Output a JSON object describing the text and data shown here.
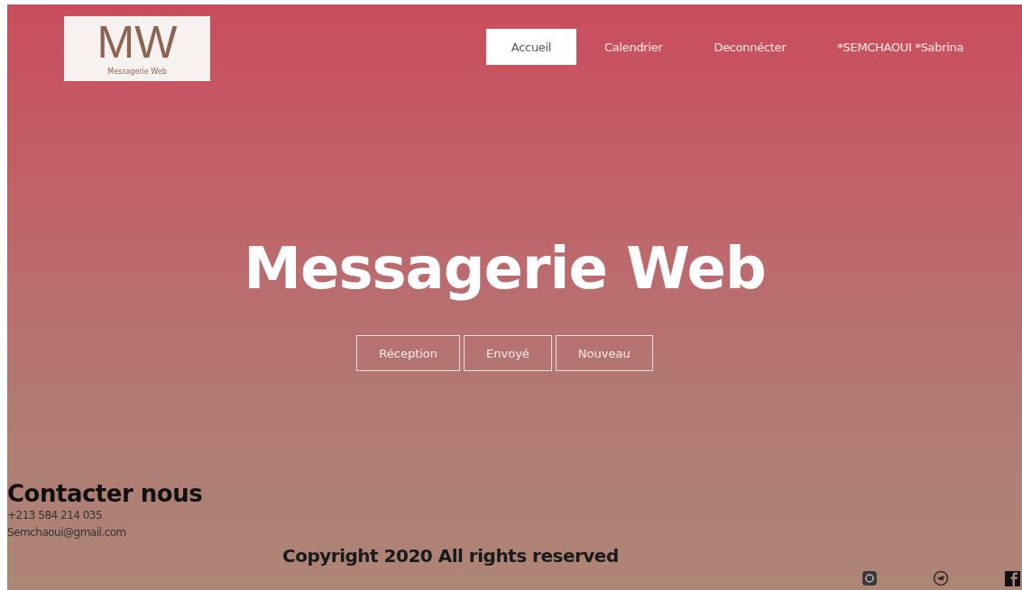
{
  "logo": {
    "mark": "MW",
    "caption": "Messagerie Web"
  },
  "nav": [
    {
      "label": "Accueil",
      "selected": true
    },
    {
      "label": "Calendrier",
      "selected": false
    },
    {
      "label": "Deconnécter",
      "selected": false
    },
    {
      "label": "*SEMCHAOUI *Sabrina",
      "selected": false
    }
  ],
  "hero": {
    "title": "Messagerie Web",
    "buttons": [
      "Réception",
      "Envoyé",
      "Nouveau"
    ]
  },
  "contact": {
    "heading": "Contacter nous",
    "phone": "+213 584 214 035",
    "email": "Semchaoui@gmail.com"
  },
  "copyright": "Copyright 2020 All rights reserved",
  "social": [
    {
      "kind": "instagram"
    },
    {
      "kind": "twitter"
    },
    {
      "kind": "facebook"
    }
  ]
}
